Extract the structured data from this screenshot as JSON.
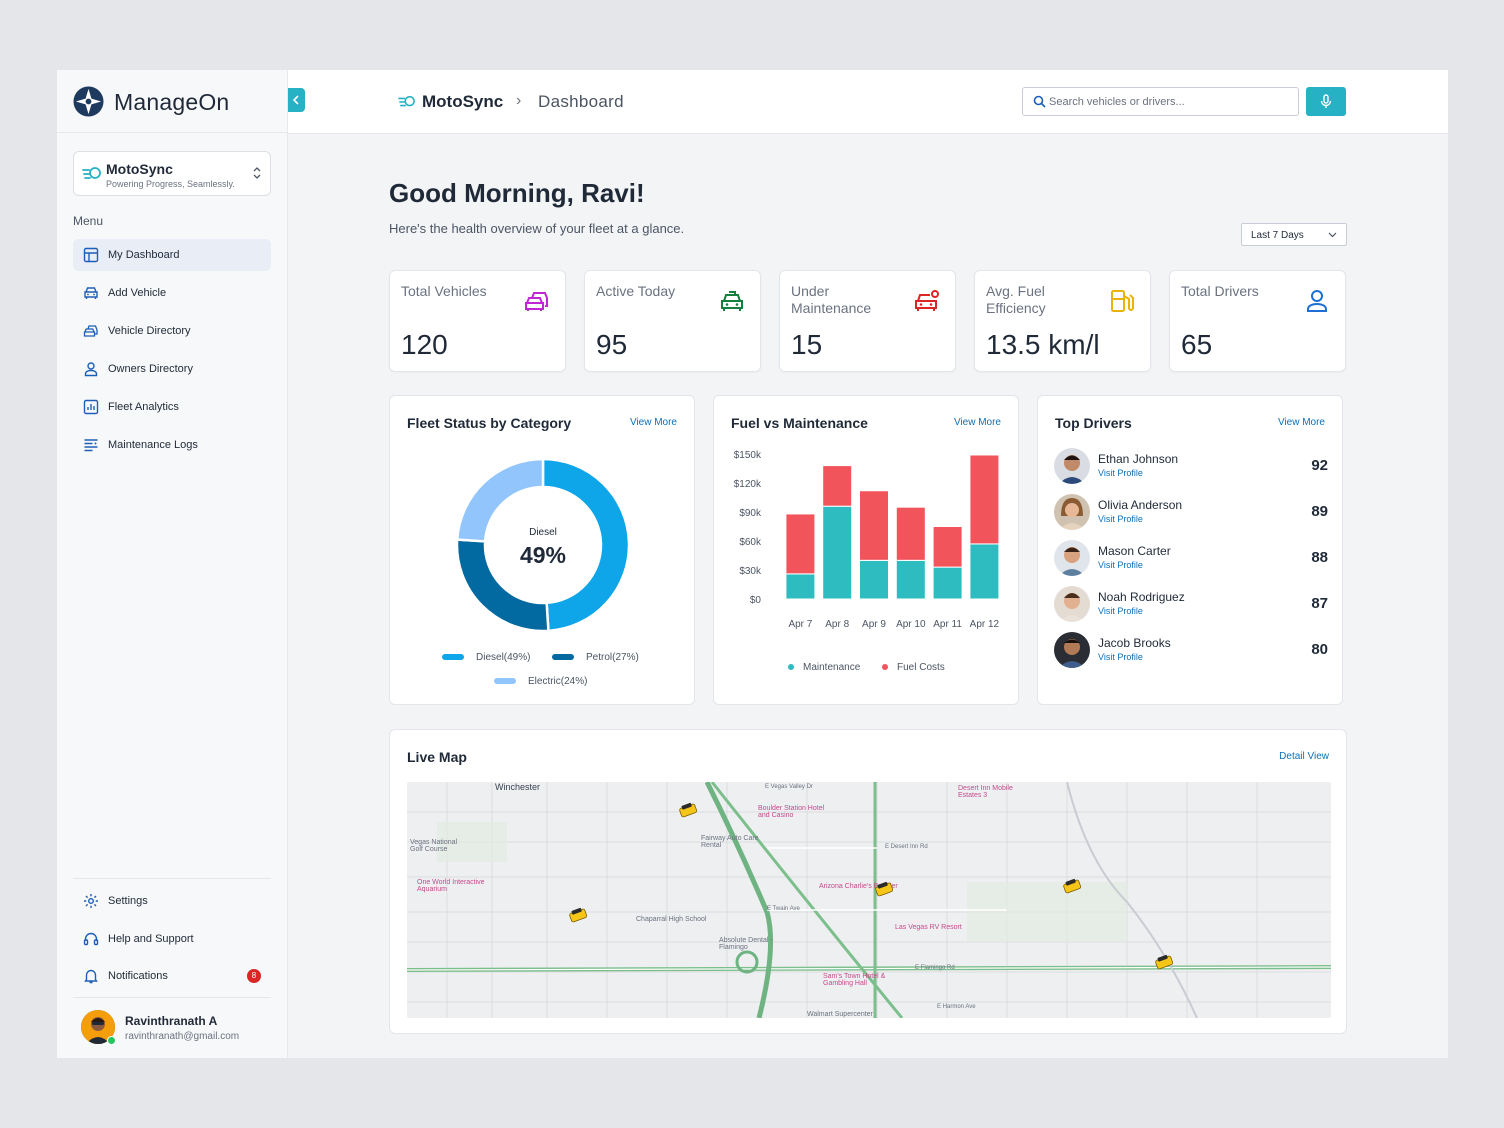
{
  "brand": {
    "name": "ManageOn"
  },
  "org": {
    "name": "MotoSync",
    "tagline": "Powering Progress, Seamlessly."
  },
  "menu_label": "Menu",
  "nav": [
    {
      "label": "My Dashboard",
      "icon": "dashboard-icon"
    },
    {
      "label": "Add Vehicle",
      "icon": "car-icon"
    },
    {
      "label": "Vehicle Directory",
      "icon": "vehicles-icon"
    },
    {
      "label": "Owners Directory",
      "icon": "user-icon"
    },
    {
      "label": "Fleet Analytics",
      "icon": "analytics-icon"
    },
    {
      "label": "Maintenance Logs",
      "icon": "logs-icon"
    }
  ],
  "bottom_nav": [
    {
      "label": "Settings",
      "icon": "gear-icon"
    },
    {
      "label": "Help and Support",
      "icon": "headset-icon"
    },
    {
      "label": "Notifications",
      "icon": "bell-icon",
      "badge": "8"
    }
  ],
  "user": {
    "name": "Ravinthranath A",
    "email": "ravinthranath@gmail.com"
  },
  "breadcrumb": {
    "app": "MotoSync",
    "separator": "›",
    "page": "Dashboard"
  },
  "search": {
    "placeholder": "Search vehicles or drivers..."
  },
  "greeting": "Good Morning, Ravi!",
  "subgreeting": "Here's the health overview of your fleet at a glance.",
  "range": "Last 7 Days",
  "stats": [
    {
      "label": "Total Vehicles",
      "value": "120",
      "icon": "cars-icon",
      "color": "#c026d3"
    },
    {
      "label": "Active Today",
      "value": "95",
      "icon": "taxi-icon",
      "color": "#15803d"
    },
    {
      "label": "Under Maintenance",
      "value": "15",
      "icon": "car-repair-icon",
      "color": "#dc2626"
    },
    {
      "label": "Avg. Fuel Efficiency",
      "value": "13.5 km/l",
      "icon": "fuel-pump-icon",
      "color": "#eab308"
    },
    {
      "label": "Total Drivers",
      "value": "65",
      "icon": "driver-icon",
      "color": "#1d6fd1"
    }
  ],
  "fleet_status": {
    "title": "Fleet Status by Category",
    "link": "View More",
    "center_label": "Diesel",
    "center_value": "49%",
    "legend": [
      "Diesel(49%)",
      "Petrol(27%)",
      "Electric(24%)"
    ]
  },
  "fuel_maintenance": {
    "title": "Fuel vs Maintenance",
    "link": "View More",
    "legend": [
      "Maintenance",
      "Fuel Costs"
    ]
  },
  "top_drivers": {
    "title": "Top Drivers",
    "link": "View More",
    "visit_label": "Visit Profile",
    "drivers": [
      {
        "name": "Ethan Johnson",
        "score": "92"
      },
      {
        "name": "Olivia Anderson",
        "score": "89"
      },
      {
        "name": "Mason Carter",
        "score": "88"
      },
      {
        "name": "Noah Rodriguez",
        "score": "87"
      },
      {
        "name": "Jacob Brooks",
        "score": "80"
      }
    ]
  },
  "live_map": {
    "title": "Live Map",
    "link": "Detail View",
    "labels": [
      "Winchester",
      "Vegas National Golf Course",
      "One World Interactive Aquarium",
      "Boulder Station Hotel and Casino",
      "Fairway Auto Care Rental",
      "Desert Inn Mobile Estates 3",
      "Arizona Charlie's Boulder",
      "Chaparral High School",
      "Absolute Dental - Flamingo",
      "Las Vegas RV Resort",
      "Sam's Town Hotel & Gambling Hall",
      "Walmart Supercenter",
      "E Vegas Valley Dr",
      "E Desert Inn Rd",
      "E Twain Ave",
      "E Flamingo Rd",
      "E Harmon Ave"
    ]
  },
  "colors": {
    "accent": "#26b1c4",
    "link": "#0f6fb5",
    "diesel": "#0ea5e9",
    "petrol": "#0369a1",
    "electric": "#93c5fd",
    "maintenance": "#2fbcc0",
    "fuel": "#f2545b"
  },
  "chart_data": [
    {
      "type": "pie",
      "title": "Fleet Status by Category",
      "categories": [
        "Diesel",
        "Petrol",
        "Electric"
      ],
      "values": [
        49,
        27,
        24
      ]
    },
    {
      "type": "bar",
      "title": "Fuel vs Maintenance",
      "stacked": true,
      "categories": [
        "Apr 7",
        "Apr 8",
        "Apr 9",
        "Apr 10",
        "Apr 11",
        "Apr 12"
      ],
      "yticks": [
        "$150k",
        "$120k",
        "$90k",
        "$60k",
        "$30k",
        "$0"
      ],
      "ylim": [
        0,
        150000
      ],
      "series": [
        {
          "name": "Maintenance",
          "values": [
            26000,
            96000,
            40000,
            40000,
            33000,
            57000
          ]
        },
        {
          "name": "Fuel Costs",
          "values": [
            62000,
            42000,
            72000,
            55000,
            42000,
            92000
          ]
        }
      ],
      "legend": "bottom"
    }
  ]
}
